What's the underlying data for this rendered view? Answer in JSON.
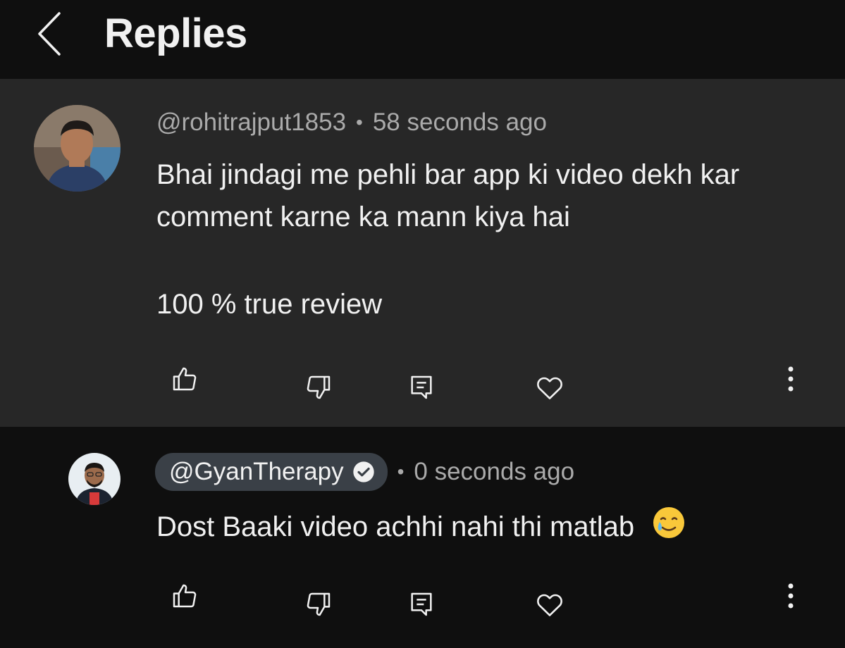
{
  "header": {
    "title": "Replies",
    "back_icon": "chevron-left-icon"
  },
  "comment": {
    "author": "@rohitrajput1853",
    "separator": "•",
    "time": "58 seconds ago",
    "text_line1": "Bhai jindagi me pehli bar app ki video  dekh kar",
    "text_line2": "comment karne ka mann kiya hai",
    "text_line3": "100 % true review",
    "actions": [
      "like-icon",
      "dislike-icon",
      "reply-icon",
      "heart-icon",
      "more-icon"
    ]
  },
  "reply": {
    "author": "@GyanTherapy",
    "verified": true,
    "separator": "•",
    "time": "0 seconds ago",
    "text": "Dost Baaki video achhi nahi thi matlab",
    "emoji": "🥲",
    "actions": [
      "like-icon",
      "dislike-icon",
      "reply-icon",
      "heart-icon",
      "more-icon"
    ]
  },
  "colors": {
    "background": "#0f0f0f",
    "highlight": "#272727",
    "meta_text": "#aaaaaa",
    "creator_chip": "#3a4047"
  }
}
